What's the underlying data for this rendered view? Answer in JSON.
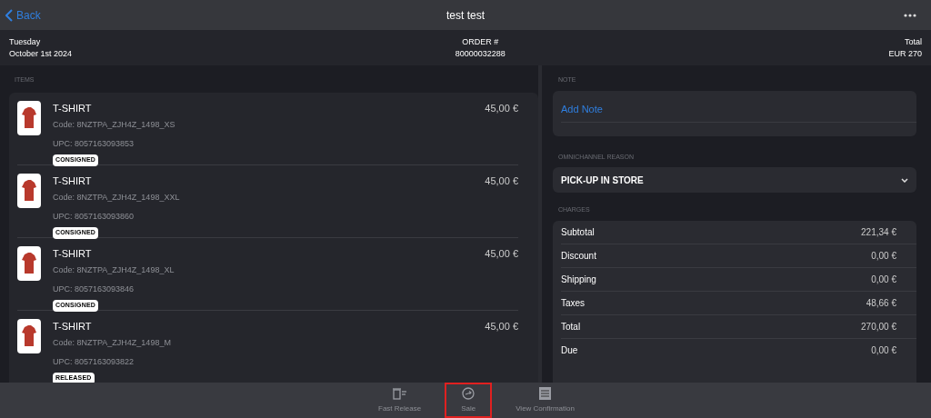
{
  "nav": {
    "back": "Back",
    "title": "test test"
  },
  "info": {
    "day": "Tuesday",
    "date": "October 1st 2024",
    "order_label": "ORDER #",
    "order_number": "80000032288",
    "total_label": "Total",
    "total_value": "EUR 270"
  },
  "items_label": "ITEMS",
  "items": [
    {
      "name": "T-SHIRT",
      "code": "Code: 8NZTPA_ZJH4Z_1498_XS",
      "upc": "UPC: 8057163093853",
      "status": "CONSIGNED",
      "price": "45,00 €"
    },
    {
      "name": "T-SHIRT",
      "code": "Code: 8NZTPA_ZJH4Z_1498_XXL",
      "upc": "UPC: 8057163093860",
      "status": "CONSIGNED",
      "price": "45,00 €"
    },
    {
      "name": "T-SHIRT",
      "code": "Code: 8NZTPA_ZJH4Z_1498_XL",
      "upc": "UPC: 8057163093846",
      "status": "CONSIGNED",
      "price": "45,00 €"
    },
    {
      "name": "T-SHIRT",
      "code": "Code: 8NZTPA_ZJH4Z_1498_M",
      "upc": "UPC: 8057163093822",
      "status": "RELEASED",
      "price": "45,00 €"
    }
  ],
  "note": {
    "label": "NOTE",
    "placeholder": "Add Note"
  },
  "reason": {
    "label": "OMNICHANNEL REASON",
    "value": "PICK-UP IN STORE"
  },
  "charges": {
    "label": "CHARGES",
    "rows": [
      {
        "label": "Subtotal",
        "value": "221,34 €"
      },
      {
        "label": "Discount",
        "value": "0,00 €"
      },
      {
        "label": "Shipping",
        "value": "0,00 €"
      },
      {
        "label": "Taxes",
        "value": "48,66 €"
      },
      {
        "label": "Total",
        "value": "270,00 €"
      },
      {
        "label": "Due",
        "value": "0,00 €"
      }
    ]
  },
  "toolbar": [
    {
      "kind": "release",
      "label": "Fast Release",
      "selected": false
    },
    {
      "kind": "sale",
      "label": "Sale",
      "selected": true
    },
    {
      "kind": "confirmation",
      "label": "View Confirmation",
      "selected": false
    }
  ]
}
